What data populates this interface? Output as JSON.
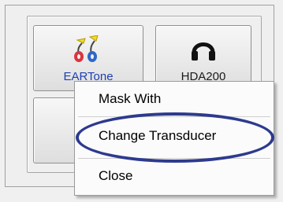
{
  "transducers": {
    "eartone_label": "EARTone",
    "hda200_label": "HDA200"
  },
  "context_menu": {
    "items": [
      {
        "label": "Mask With"
      },
      {
        "label": "Change Transducer"
      },
      {
        "label": "Close"
      }
    ],
    "highlighted_item": "Change Transducer"
  },
  "colors": {
    "highlight_ellipse": "#2d3a8e",
    "eartone_label": "#1f3fb2"
  }
}
